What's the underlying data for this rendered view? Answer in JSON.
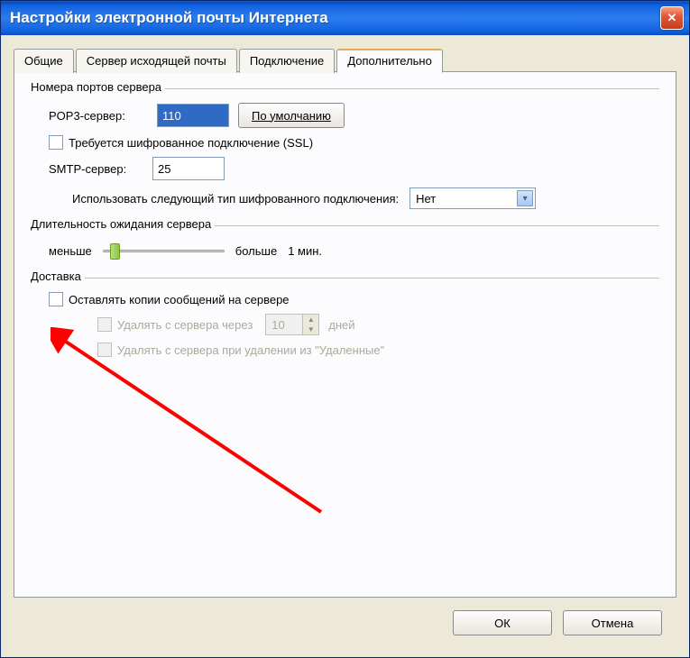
{
  "titlebar": {
    "title": "Настройки электронной почты Интернета",
    "closeGlyph": "✕"
  },
  "tabs": {
    "general": "Общие",
    "outgoing": "Сервер исходящей почты",
    "connection": "Подключение",
    "advanced": "Дополнительно"
  },
  "ports": {
    "legend": "Номера портов сервера",
    "pop3_label": "POP3-сервер:",
    "pop3_value": "110",
    "default_btn": "По умолчанию",
    "ssl_label": "Требуется шифрованное подключение (SSL)",
    "smtp_label": "SMTP-сервер:",
    "smtp_value": "25",
    "enc_label": "Использовать следующий тип шифрованного подключения:",
    "enc_select": "Нет",
    "dropdownGlyph": "▾"
  },
  "timeout": {
    "legend": "Длительность ожидания сервера",
    "less": "меньше",
    "more": "больше",
    "value": "1 мин."
  },
  "delivery": {
    "legend": "Доставка",
    "leave_copy": "Оставлять копии сообщений на сервере",
    "delete_after": "Удалять с сервера через",
    "days_value": "10",
    "days_label": "дней",
    "spinUp": "▲",
    "spinDown": "▼",
    "delete_on_trash": "Удалять с сервера при удалении из \"Удаленные\""
  },
  "footer": {
    "ok": "ОК",
    "cancel": "Отмена"
  }
}
